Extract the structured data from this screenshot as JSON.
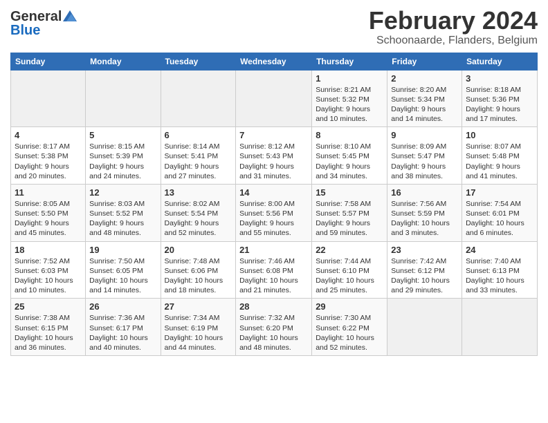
{
  "header": {
    "logo_general": "General",
    "logo_blue": "Blue",
    "title": "February 2024",
    "subtitle": "Schoonaarde, Flanders, Belgium"
  },
  "days_of_week": [
    "Sunday",
    "Monday",
    "Tuesday",
    "Wednesday",
    "Thursday",
    "Friday",
    "Saturday"
  ],
  "weeks": [
    [
      {
        "day": "",
        "info": ""
      },
      {
        "day": "",
        "info": ""
      },
      {
        "day": "",
        "info": ""
      },
      {
        "day": "",
        "info": ""
      },
      {
        "day": "1",
        "info": "Sunrise: 8:21 AM\nSunset: 5:32 PM\nDaylight: 9 hours and 10 minutes."
      },
      {
        "day": "2",
        "info": "Sunrise: 8:20 AM\nSunset: 5:34 PM\nDaylight: 9 hours and 14 minutes."
      },
      {
        "day": "3",
        "info": "Sunrise: 8:18 AM\nSunset: 5:36 PM\nDaylight: 9 hours and 17 minutes."
      }
    ],
    [
      {
        "day": "4",
        "info": "Sunrise: 8:17 AM\nSunset: 5:38 PM\nDaylight: 9 hours and 20 minutes."
      },
      {
        "day": "5",
        "info": "Sunrise: 8:15 AM\nSunset: 5:39 PM\nDaylight: 9 hours and 24 minutes."
      },
      {
        "day": "6",
        "info": "Sunrise: 8:14 AM\nSunset: 5:41 PM\nDaylight: 9 hours and 27 minutes."
      },
      {
        "day": "7",
        "info": "Sunrise: 8:12 AM\nSunset: 5:43 PM\nDaylight: 9 hours and 31 minutes."
      },
      {
        "day": "8",
        "info": "Sunrise: 8:10 AM\nSunset: 5:45 PM\nDaylight: 9 hours and 34 minutes."
      },
      {
        "day": "9",
        "info": "Sunrise: 8:09 AM\nSunset: 5:47 PM\nDaylight: 9 hours and 38 minutes."
      },
      {
        "day": "10",
        "info": "Sunrise: 8:07 AM\nSunset: 5:48 PM\nDaylight: 9 hours and 41 minutes."
      }
    ],
    [
      {
        "day": "11",
        "info": "Sunrise: 8:05 AM\nSunset: 5:50 PM\nDaylight: 9 hours and 45 minutes."
      },
      {
        "day": "12",
        "info": "Sunrise: 8:03 AM\nSunset: 5:52 PM\nDaylight: 9 hours and 48 minutes."
      },
      {
        "day": "13",
        "info": "Sunrise: 8:02 AM\nSunset: 5:54 PM\nDaylight: 9 hours and 52 minutes."
      },
      {
        "day": "14",
        "info": "Sunrise: 8:00 AM\nSunset: 5:56 PM\nDaylight: 9 hours and 55 minutes."
      },
      {
        "day": "15",
        "info": "Sunrise: 7:58 AM\nSunset: 5:57 PM\nDaylight: 9 hours and 59 minutes."
      },
      {
        "day": "16",
        "info": "Sunrise: 7:56 AM\nSunset: 5:59 PM\nDaylight: 10 hours and 3 minutes."
      },
      {
        "day": "17",
        "info": "Sunrise: 7:54 AM\nSunset: 6:01 PM\nDaylight: 10 hours and 6 minutes."
      }
    ],
    [
      {
        "day": "18",
        "info": "Sunrise: 7:52 AM\nSunset: 6:03 PM\nDaylight: 10 hours and 10 minutes."
      },
      {
        "day": "19",
        "info": "Sunrise: 7:50 AM\nSunset: 6:05 PM\nDaylight: 10 hours and 14 minutes."
      },
      {
        "day": "20",
        "info": "Sunrise: 7:48 AM\nSunset: 6:06 PM\nDaylight: 10 hours and 18 minutes."
      },
      {
        "day": "21",
        "info": "Sunrise: 7:46 AM\nSunset: 6:08 PM\nDaylight: 10 hours and 21 minutes."
      },
      {
        "day": "22",
        "info": "Sunrise: 7:44 AM\nSunset: 6:10 PM\nDaylight: 10 hours and 25 minutes."
      },
      {
        "day": "23",
        "info": "Sunrise: 7:42 AM\nSunset: 6:12 PM\nDaylight: 10 hours and 29 minutes."
      },
      {
        "day": "24",
        "info": "Sunrise: 7:40 AM\nSunset: 6:13 PM\nDaylight: 10 hours and 33 minutes."
      }
    ],
    [
      {
        "day": "25",
        "info": "Sunrise: 7:38 AM\nSunset: 6:15 PM\nDaylight: 10 hours and 36 minutes."
      },
      {
        "day": "26",
        "info": "Sunrise: 7:36 AM\nSunset: 6:17 PM\nDaylight: 10 hours and 40 minutes."
      },
      {
        "day": "27",
        "info": "Sunrise: 7:34 AM\nSunset: 6:19 PM\nDaylight: 10 hours and 44 minutes."
      },
      {
        "day": "28",
        "info": "Sunrise: 7:32 AM\nSunset: 6:20 PM\nDaylight: 10 hours and 48 minutes."
      },
      {
        "day": "29",
        "info": "Sunrise: 7:30 AM\nSunset: 6:22 PM\nDaylight: 10 hours and 52 minutes."
      },
      {
        "day": "",
        "info": ""
      },
      {
        "day": "",
        "info": ""
      }
    ]
  ]
}
